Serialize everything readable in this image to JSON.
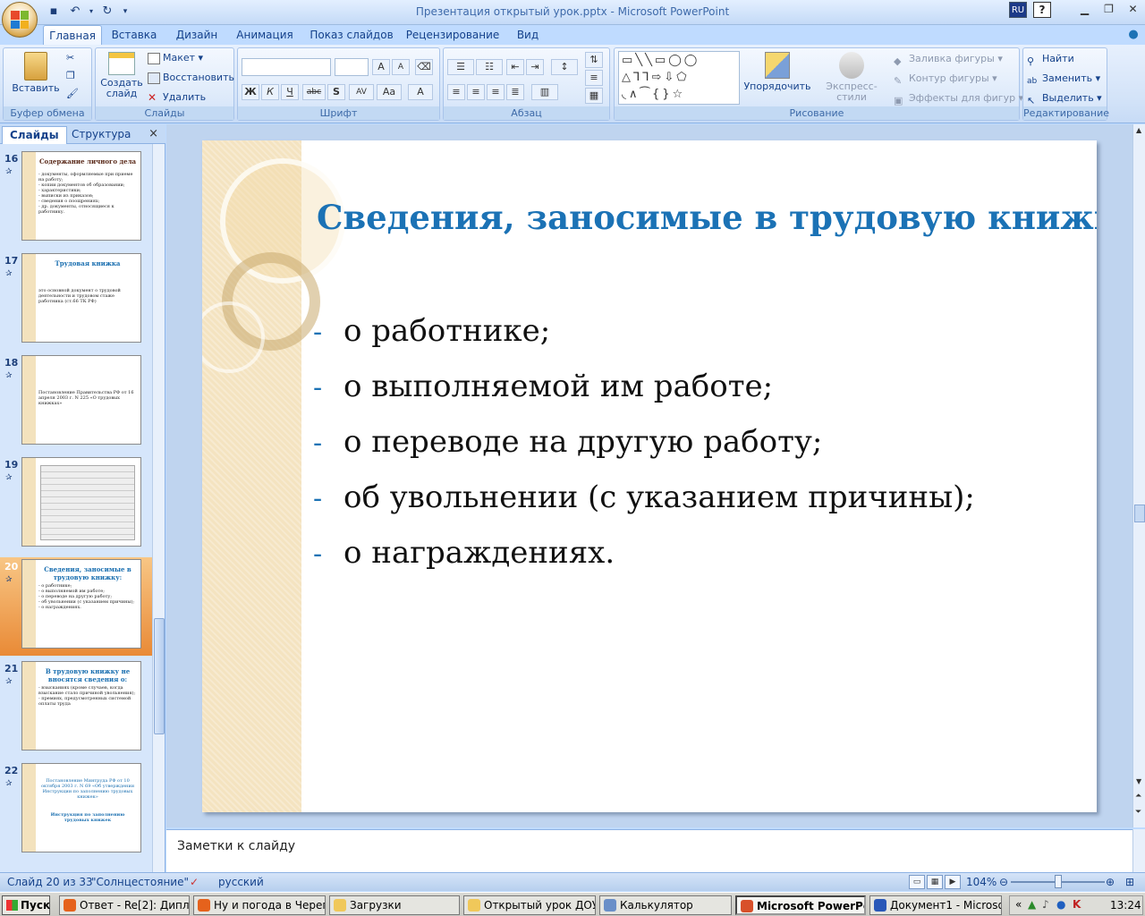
{
  "window": {
    "title": "Презентация открытый урок.pptx - Microsoft PowerPoint",
    "lang": "RU",
    "help": "?"
  },
  "ribbon": {
    "tabs": [
      "Главная",
      "Вставка",
      "Дизайн",
      "Анимация",
      "Показ слайдов",
      "Рецензирование",
      "Вид"
    ],
    "clipboard": {
      "paste": "Вставить",
      "label": "Буфер обмена"
    },
    "slides": {
      "new_slide": "Создать слайд",
      "layout": "Макет",
      "reset": "Восстановить",
      "delete": "Удалить",
      "label": "Слайды"
    },
    "font": {
      "label": "Шрифт",
      "bold": "Ж",
      "italic": "К",
      "underline": "Ч",
      "strike": "abc",
      "shadow": "S",
      "spacing": "AV",
      "case": "Aa",
      "grow": "A",
      "shrink": "A"
    },
    "paragraph": {
      "label": "Абзац"
    },
    "drawing": {
      "arrange": "Упорядочить",
      "quick_styles": "Экспресс-стили",
      "fill": "Заливка фигуры",
      "outline": "Контур фигуры",
      "effects": "Эффекты для фигур",
      "label": "Рисование",
      "shapes_row1": "▭╲╲▭◯◯",
      "shapes_row2": "△⅂⅂⇨⇩⬠",
      "shapes_row3": "◟∧⁀{}☆"
    },
    "editing": {
      "find": "Найти",
      "replace": "Заменить",
      "select": "Выделить",
      "label": "Редактирование"
    }
  },
  "pane": {
    "tab_slides": "Слайды",
    "tab_outline": "Структура",
    "close": "×",
    "thumbs": [
      {
        "num": "16",
        "title": "Содержание личного дела",
        "body": "- документы, оформляемые при приеме на работу;\n- копии документов об образовании;\n- характеристики;\n- выписки из приказов;\n- сведения о поощрениях;\n- др. документы, относящиеся к работнику."
      },
      {
        "num": "17",
        "title": "Трудовая книжка",
        "body": "это основной документ о трудовой деятельности и трудовом стаже работника (ст.66 ТК РФ)"
      },
      {
        "num": "18",
        "title": "",
        "body": "Постановление Правительства РФ от 16 апреля 2003 г. N 225 «О трудовых книжках»"
      },
      {
        "num": "19",
        "title": "",
        "body": ""
      },
      {
        "num": "20",
        "title": "Сведения, заносимые в трудовую книжку:",
        "body": "- о работнике;\n- о выполняемой им работе;\n- о переводе на другую работу;\n- об увольнении (с указанием причины);\n- о награждениях."
      },
      {
        "num": "21",
        "title": "В трудовую книжку не вносятся сведения о:",
        "body": "- взысканиях (кроме случаев, когда взыскание стало причиной увольнения);\n- премиях, предусмотренных системой оплаты труда"
      },
      {
        "num": "22",
        "title": "Постановление Минтруда РФ от 10 октября 2003 г. N 69 «Об утверждении Инструкции по заполнению трудовых книжек»",
        "body": "Инструкция по заполнению трудовых книжек"
      }
    ]
  },
  "slide": {
    "title": "Сведения, заносимые в трудовую книжку:",
    "bullet_dash": "-",
    "bullets": [
      "о работнике;",
      "о выполняемой им работе;",
      "о переводе на другую работу;",
      "об увольнении (с указанием причины);",
      "о награждениях."
    ]
  },
  "notes": {
    "placeholder": "Заметки к слайду"
  },
  "status": {
    "slide_pos": "Слайд 20 из 33",
    "theme": "\"Солнцестояние\"",
    "language": "русский",
    "zoom": "104%"
  },
  "taskbar": {
    "start": "Пуск",
    "items": [
      {
        "label": "Ответ - Re[2]: Дипло...",
        "color": "#e5621c"
      },
      {
        "label": "Ну и погода в Череп...",
        "color": "#e5621c"
      },
      {
        "label": "Загрузки",
        "color": "#f0c85a"
      },
      {
        "label": "Открытый урок ДОУ",
        "color": "#f0c85a"
      },
      {
        "label": "Калькулятор",
        "color": "#6a8fc8"
      },
      {
        "label": "Microsoft PowerPoi...",
        "color": "#d8502a"
      },
      {
        "label": "Документ1 - Microsof...",
        "color": "#2a58b8"
      }
    ],
    "clock": "13:24"
  },
  "colors": {
    "title_blue": "#1b72b5",
    "ribbon_text": "#15428b",
    "selected_thumb": "#e98a36"
  }
}
